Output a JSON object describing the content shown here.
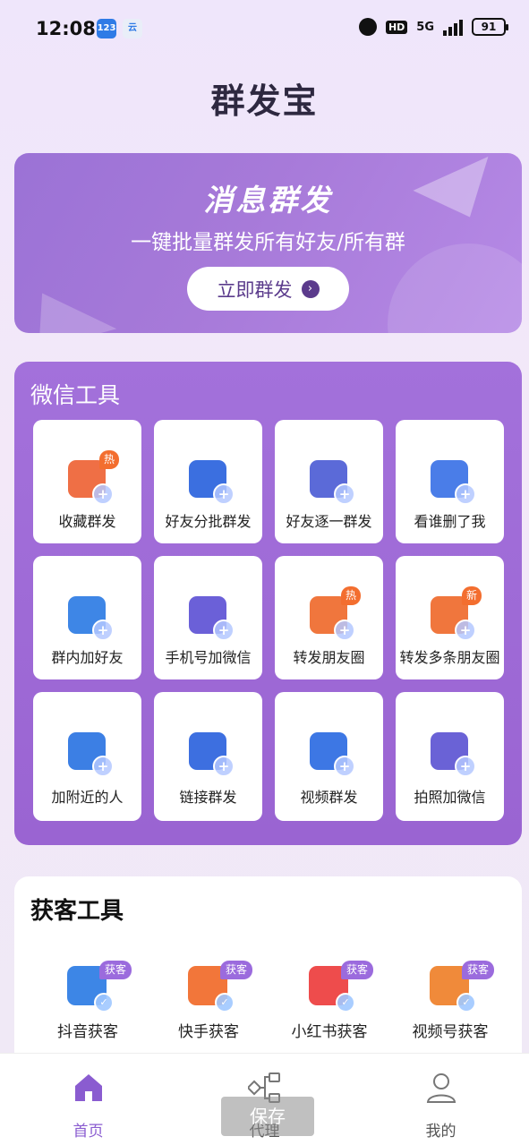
{
  "status_bar": {
    "time": "12:08",
    "app1": "123",
    "app2": "云",
    "hd": "HD",
    "network": "5G",
    "battery": "91"
  },
  "app_title": "群发宝",
  "banner": {
    "title": "消息群发",
    "subtitle": "一键批量群发所有好友/所有群",
    "button": "立即群发"
  },
  "wechat_tools": {
    "title": "微信工具",
    "items": [
      {
        "label": "收藏群发",
        "tag": "热",
        "icon": "star-bag-icon",
        "color": "#ef6f45"
      },
      {
        "label": "好友分批群发",
        "tag": "",
        "icon": "card-plane-icon",
        "color": "#3b6fe0"
      },
      {
        "label": "好友逐一群发",
        "tag": "",
        "icon": "users-plane-icon",
        "color": "#5b6ad8"
      },
      {
        "label": "看谁删了我",
        "tag": "",
        "icon": "broom-icon",
        "color": "#4a7de8"
      },
      {
        "label": "群内加好友",
        "tag": "",
        "icon": "user-add-icon",
        "color": "#3e86e6"
      },
      {
        "label": "手机号加微信",
        "tag": "",
        "icon": "phone-add-icon",
        "color": "#6b60d8"
      },
      {
        "label": "转发朋友圈",
        "tag": "热",
        "icon": "aperture-icon",
        "color": "#f0763d"
      },
      {
        "label": "转发多条朋友圈",
        "tag": "新",
        "icon": "aperture-icon",
        "color": "#f0763d"
      },
      {
        "label": "加附近的人",
        "tag": "",
        "icon": "location-user-icon",
        "color": "#3c7fe4"
      },
      {
        "label": "链接群发",
        "tag": "",
        "icon": "link-a-icon",
        "color": "#3d6fe0"
      },
      {
        "label": "视频群发",
        "tag": "",
        "icon": "tv-icon",
        "color": "#3d77e4"
      },
      {
        "label": "拍照加微信",
        "tag": "",
        "icon": "camera-add-icon",
        "color": "#6a62d6"
      }
    ]
  },
  "acquire_tools": {
    "title": "获客工具",
    "items": [
      {
        "label": "抖音获客",
        "tag": "获客",
        "icon": "douyin-icon",
        "color": "#3d86e6"
      },
      {
        "label": "快手获客",
        "tag": "获客",
        "icon": "kuaishou-icon",
        "color": "#f2763a"
      },
      {
        "label": "小红书获客",
        "tag": "获客",
        "icon": "xiaohongshu-icon",
        "color": "#ee4c4c"
      },
      {
        "label": "视频号获客",
        "tag": "获客",
        "icon": "shipinhao-icon",
        "color": "#f08a3a"
      }
    ]
  },
  "tabs": [
    {
      "label": "首页",
      "icon": "home-icon",
      "active": true
    },
    {
      "label": "代理",
      "icon": "network-icon",
      "active": false
    },
    {
      "label": "我的",
      "icon": "user-icon",
      "active": false
    }
  ],
  "overlay": {
    "save": "保存"
  }
}
